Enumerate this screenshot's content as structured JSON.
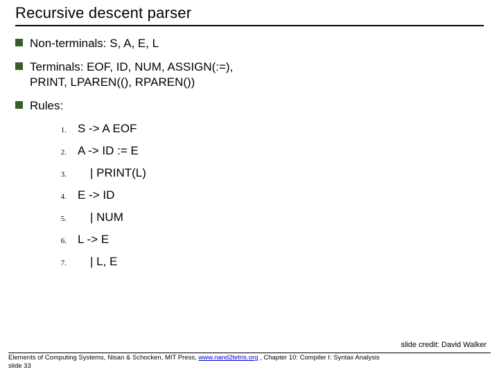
{
  "title": "Recursive descent parser",
  "bullets": {
    "nonterminals": "Non-terminals: S, A, E, L",
    "terminals": "Terminals: EOF, ID, NUM, ASSIGN(:=), PRINT, LPAREN((), RPAREN())",
    "rules_label": "Rules:"
  },
  "rules": {
    "r1": {
      "n": "1.",
      "t": "S -> A EOF"
    },
    "r2": {
      "n": "2.",
      "t": "A -> ID := E"
    },
    "r3": {
      "n": "3.",
      "t": "| PRINT(L)"
    },
    "r4": {
      "n": "4.",
      "t": "E -> ID"
    },
    "r5": {
      "n": "5.",
      "t": "| NUM"
    },
    "r6": {
      "n": "6.",
      "t": "L -> E"
    },
    "r7": {
      "n": "7.",
      "t": "| L, E"
    }
  },
  "credit": "slide credit: David Walker",
  "footer": {
    "pre": "Elements of Computing Systems, Nisan & Schocken, MIT Press, ",
    "link": "www.nand2tetris.org",
    "post": " , Chapter 10: Compiler I: Syntax Analysis",
    "slide": "slide 33"
  }
}
